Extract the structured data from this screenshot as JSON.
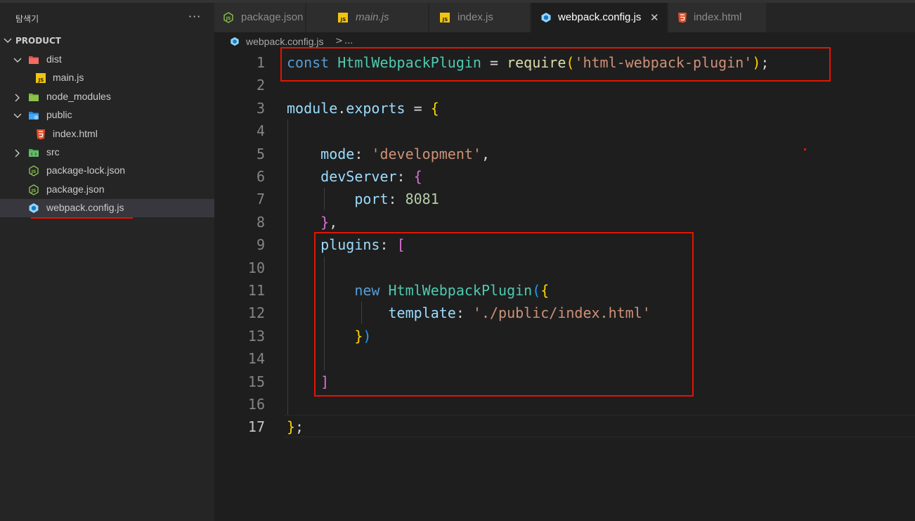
{
  "sidebar": {
    "title": "탐색기",
    "more": "···",
    "project": "PRODUCT",
    "tree": [
      {
        "label": "dist",
        "type": "folder",
        "expanded": true,
        "depth": 0,
        "icon": "folder-dist-icon"
      },
      {
        "label": "main.js",
        "type": "file",
        "depth": 1,
        "icon": "js-file-icon"
      },
      {
        "label": "node_modules",
        "type": "folder",
        "expanded": false,
        "depth": 0,
        "icon": "folder-node-icon"
      },
      {
        "label": "public",
        "type": "folder",
        "expanded": true,
        "depth": 0,
        "icon": "folder-public-icon"
      },
      {
        "label": "index.html",
        "type": "file",
        "depth": 1,
        "icon": "html-file-icon"
      },
      {
        "label": "src",
        "type": "folder",
        "expanded": false,
        "depth": 0,
        "icon": "folder-src-icon"
      },
      {
        "label": "package-lock.json",
        "type": "file",
        "depth": 0,
        "icon": "node-json-icon"
      },
      {
        "label": "package.json",
        "type": "file",
        "depth": 0,
        "icon": "node-json-icon"
      },
      {
        "label": "webpack.config.js",
        "type": "file",
        "depth": 0,
        "icon": "webpack-icon",
        "selected": true
      }
    ]
  },
  "tabs": [
    {
      "label": "package.json",
      "icon": "node-json-icon",
      "active": false,
      "italic": false
    },
    {
      "label": "main.js",
      "icon": "js-file-icon",
      "active": false,
      "italic": true
    },
    {
      "label": "index.js",
      "icon": "js-file-icon",
      "active": false,
      "italic": false
    },
    {
      "label": "webpack.config.js",
      "icon": "webpack-icon",
      "active": true,
      "italic": false,
      "close": "✕"
    },
    {
      "label": "index.html",
      "icon": "html-file-icon",
      "active": false,
      "italic": false
    }
  ],
  "breadcrumb": {
    "file": "webpack.config.js",
    "separator": ">",
    "more": "..."
  },
  "editor": {
    "current_line": 17,
    "line_numbers": [
      "1",
      "2",
      "3",
      "4",
      "5",
      "6",
      "7",
      "8",
      "9",
      "10",
      "11",
      "12",
      "13",
      "14",
      "15",
      "16",
      "17"
    ]
  },
  "colors": {
    "accent_red": "#e51400",
    "keyword": "#569cd6",
    "class": "#4ec9b0",
    "string": "#ce9178",
    "property": "#9cdcfe",
    "number": "#b5cea8"
  }
}
